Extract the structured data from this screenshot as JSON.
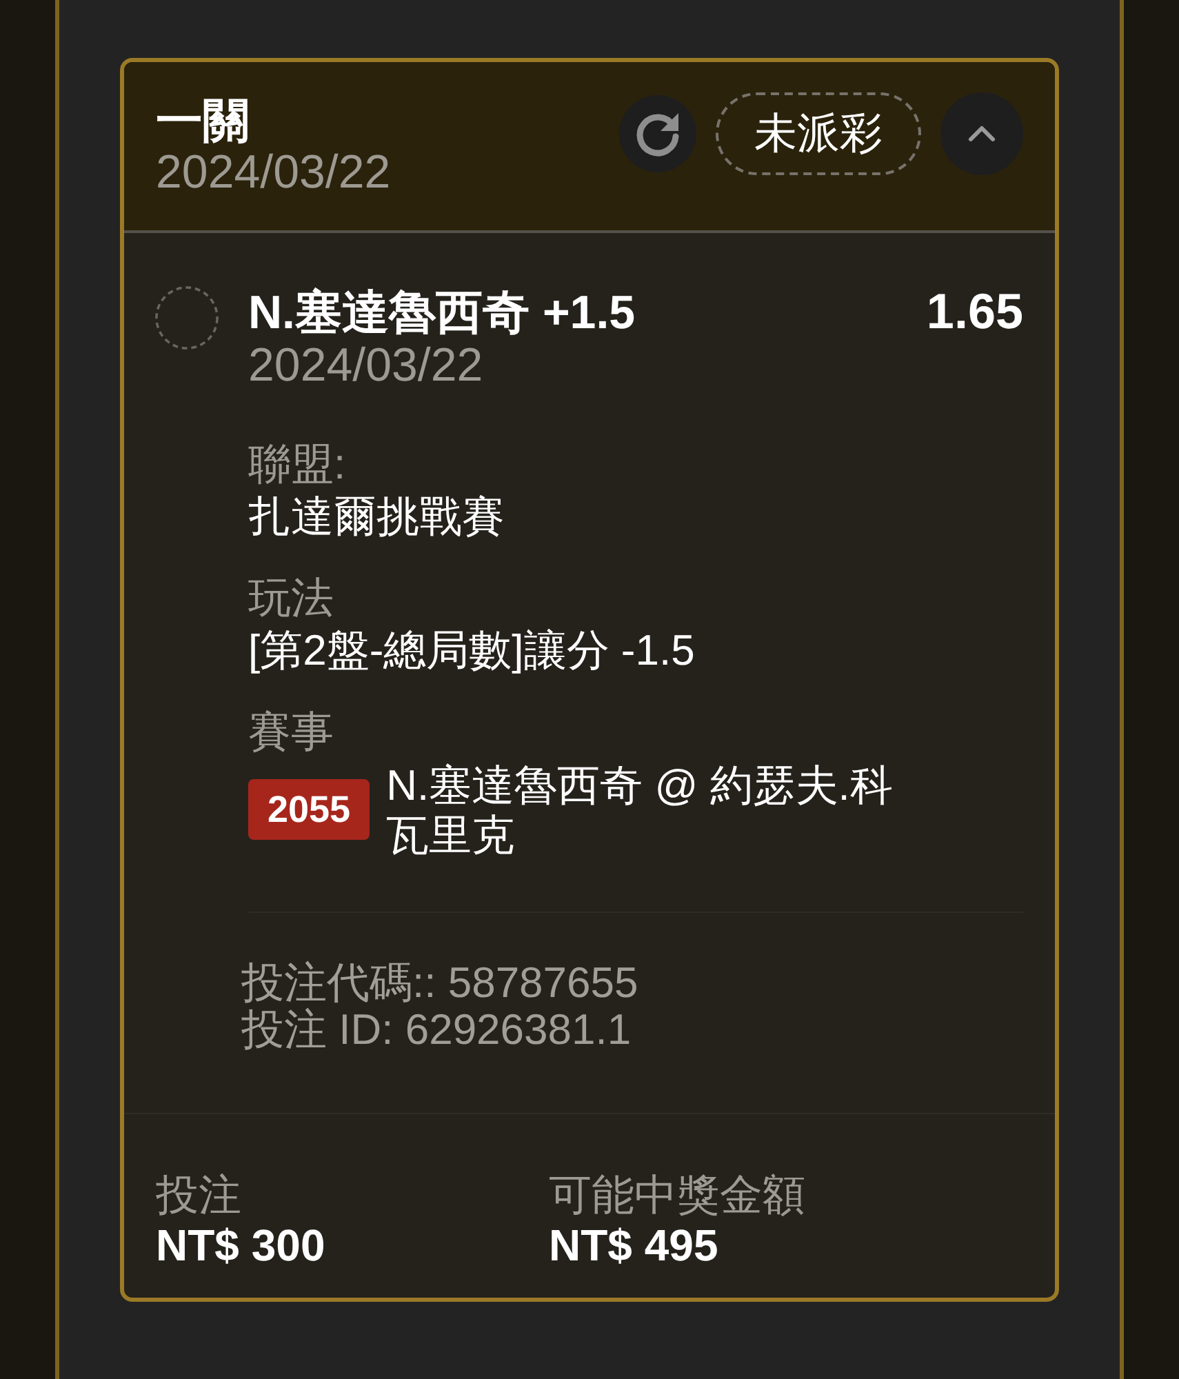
{
  "bet": {
    "title": "一關",
    "date": "2024/03/22",
    "status": "未派彩",
    "expanded": true
  },
  "selection": {
    "name": "N.塞達魯西奇 +1.5",
    "date": "2024/03/22",
    "odds": "1.65"
  },
  "details": [
    {
      "kind": "text",
      "label": "聯盟:",
      "value": "扎達爾挑戰賽"
    },
    {
      "kind": "text",
      "label": "玩法",
      "value": "[第2盤-總局數]讓分 -1.5"
    },
    {
      "kind": "event",
      "label": "賽事",
      "badge": "2055",
      "value": "N.塞達魯西奇 @ 約瑟夫.科瓦里克"
    }
  ],
  "references": [
    "投注代碼:: 58787655",
    "投注 ID: 62926381.1"
  ],
  "summary": [
    {
      "label": "投注",
      "amount": "NT$ 300"
    },
    {
      "label": "可能中獎金額",
      "amount": "NT$ 495"
    }
  ]
}
